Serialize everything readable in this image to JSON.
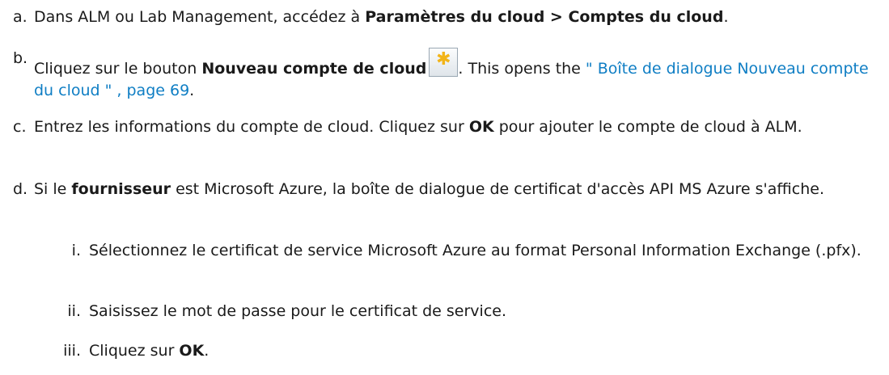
{
  "steps": [
    {
      "label": "a.",
      "pre": "Dans ALM ou Lab Management, accédez à ",
      "bold": "Paramètres du cloud > Comptes du cloud",
      "post": "."
    },
    {
      "label": "b.",
      "pre": "Cliquez sur le bouton ",
      "bold": "Nouveau compte de cloud",
      "mid": ". This opens the ",
      "link": "\" Boîte de dialogue Nouveau compte du cloud \" , page 69",
      "post": "."
    },
    {
      "label": "c.",
      "pre": "Entrez les informations du compte de cloud. Cliquez sur ",
      "bold": "OK",
      "post": " pour ajouter le compte de cloud à ALM."
    },
    {
      "label": "d.",
      "pre": "Si le ",
      "bold": "fournisseur",
      "post": " est Microsoft Azure, la boîte de dialogue de certificat d'accès API MS Azure s'affiche."
    }
  ],
  "substeps": [
    {
      "label": "i.",
      "text": "Sélectionnez le certificat de service Microsoft Azure au format Personal Information Exchange (.pfx)."
    },
    {
      "label": "ii.",
      "text": "Saisissez le mot de passe pour le certificat de service."
    },
    {
      "label": "iii.",
      "pre": "Cliquez sur ",
      "bold": "OK",
      "post": "."
    }
  ],
  "icons": {
    "new_button": "asterisk-icon",
    "color": "#f2b418"
  }
}
